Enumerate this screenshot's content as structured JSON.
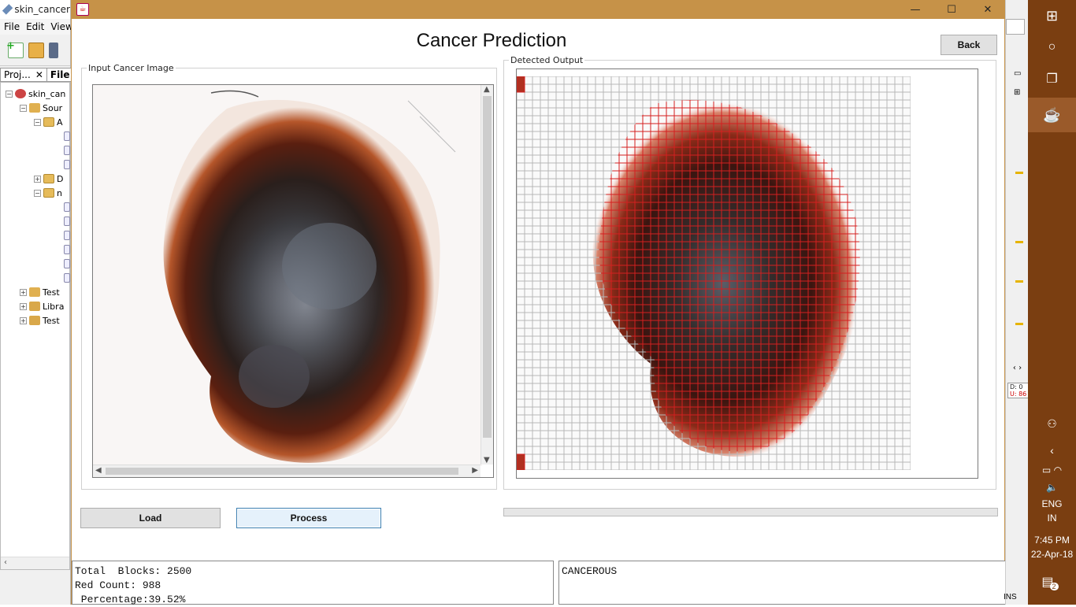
{
  "ide": {
    "title": "skin_cancer",
    "menu": [
      "File",
      "Edit",
      "View"
    ],
    "tabs": [
      "Proj...",
      "File"
    ],
    "tree": [
      {
        "label": "skin_can",
        "indent": 0
      },
      {
        "label": "Sour",
        "indent": 1
      },
      {
        "label": "A",
        "indent": 2
      },
      {
        "label": "D",
        "indent": 2
      },
      {
        "label": "n",
        "indent": 2
      },
      {
        "label": "Test",
        "indent": 1
      },
      {
        "label": "Libra",
        "indent": 1
      },
      {
        "label": "Test",
        "indent": 1
      }
    ]
  },
  "window": {
    "heading": "Cancer Prediction",
    "back_label": "Back",
    "input_panel_title": "Input Cancer Image",
    "output_panel_title": "Detected Output",
    "load_label": "Load",
    "process_label": "Process",
    "stats": {
      "line1": "Total  Blocks: 2500",
      "line2": "Red Count: 988",
      "line3": " Percentage:39.52%"
    },
    "result": "CANCEROUS",
    "progress": 0
  },
  "taskbar": {
    "time": "7:45 PM",
    "date": "22-Apr-18",
    "lang1": "ENG",
    "lang2": "IN",
    "net_d": "D: 0",
    "net_u": "U: 86",
    "notif_count": "2",
    "ins": "INS"
  },
  "colors": {
    "titlebar": "#c69248",
    "taskbar": "#7a3e11",
    "detect_red": "#d42020"
  }
}
